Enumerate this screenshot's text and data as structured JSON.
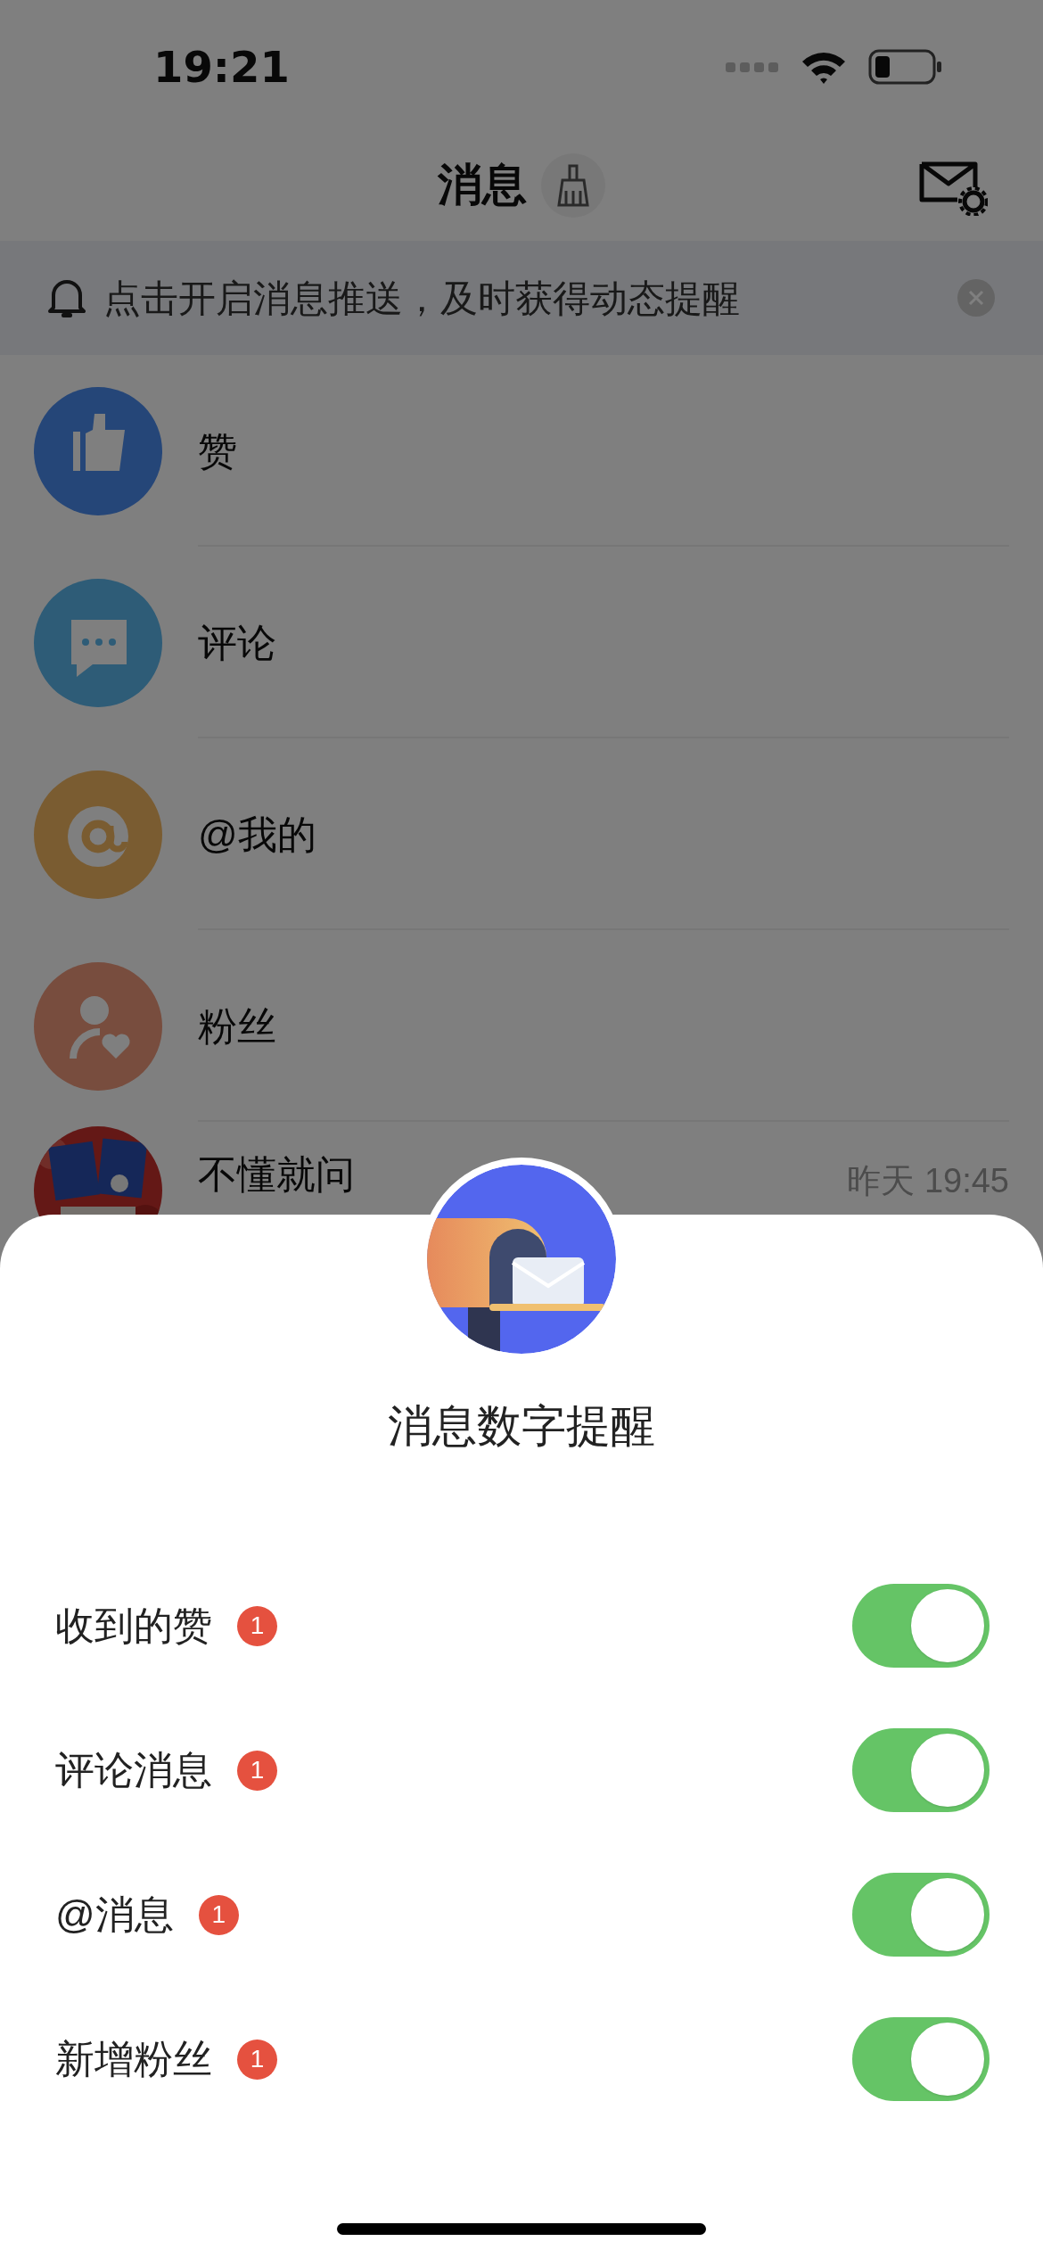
{
  "status_bar": {
    "time": "19:21"
  },
  "header": {
    "title": "消息"
  },
  "notice": {
    "text": "点击开启消息推送，及时获得动态提醒"
  },
  "conversations": [
    {
      "kind": "likes",
      "name": "赞"
    },
    {
      "kind": "comments",
      "name": "评论"
    },
    {
      "kind": "mentions",
      "name": "@我的"
    },
    {
      "kind": "fans",
      "name": "粉丝"
    },
    {
      "kind": "picture",
      "name": "不懂就问",
      "time": "昨天 19:45"
    }
  ],
  "sheet": {
    "title": "消息数字提醒",
    "settings": [
      {
        "label": "收到的赞",
        "badge": "1",
        "on": true
      },
      {
        "label": "评论消息",
        "badge": "1",
        "on": true
      },
      {
        "label": "@消息",
        "badge": "1",
        "on": true
      },
      {
        "label": "新增粉丝",
        "badge": "1",
        "on": true
      }
    ]
  }
}
